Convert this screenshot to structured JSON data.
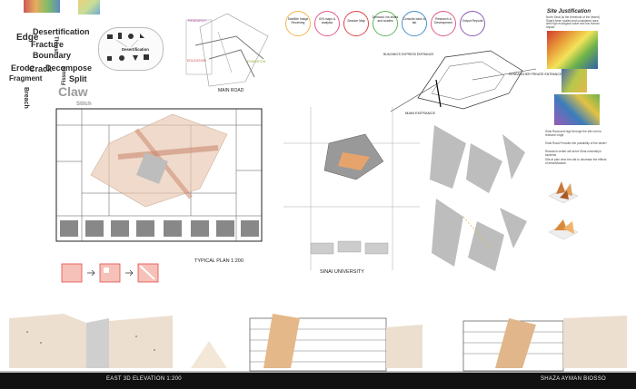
{
  "wordcloud": [
    "Edge",
    "Desertification",
    "Fracture",
    "Boundary",
    "Erode",
    "Crack",
    "Decompose",
    "Fragment",
    "Split",
    "Breach",
    "Fissure",
    "Claw",
    "Stitch",
    "Thrust"
  ],
  "process_steps": [
    {
      "label": "Satellite Image Receiving",
      "color": "#f2b84b"
    },
    {
      "label": "GIS maps & analysis",
      "color": "#e35a8c"
    },
    {
      "label": "Session Map",
      "color": "#e04646"
    },
    {
      "label": "Demand: ink slides and studies",
      "color": "#61b55a"
    },
    {
      "label": "Consults back to lab",
      "color": "#4a90c8"
    },
    {
      "label": "Research & Development",
      "color": "#e35a8c"
    },
    {
      "label": "Output Reports",
      "color": "#8e5ab8"
    }
  ],
  "desertification_label": "Desertification",
  "diagram_labels": {
    "research": "RESEARCH",
    "education": "EDUCATION",
    "exhibit": "EXHIBITION",
    "main_road": "MAIN ROAD"
  },
  "site_labels": {
    "building_entrance": "BUILDING'S EXPRESS ENTRANCE",
    "researcher_private": "RESEARCHER PRIVATE ENTRANCE",
    "main_entrance": "MAIN ENTRANCE",
    "sinai_university": "SINAI UNIVERSITY"
  },
  "plan_title": "TYPICAL PLAN 1:200",
  "site_justification": {
    "title": "Site Justification",
    "text": "North Sinai (is the threshold of the desert) Sinai’s been scaled and considered area with high ecological value and low human impact"
  },
  "site_notes": [
    "Sinai Road and high through the site next to research edge",
    "Sinai Road Provides the possibility of the desert",
    "Research center will serve Sinai university's students",
    "Site at plan view the site to decrease the effects of desertification"
  ],
  "footer": {
    "elevation": "EAST 3D ELEVATION 1:200",
    "author": "SHAZA AYMAN BIOSSO"
  }
}
